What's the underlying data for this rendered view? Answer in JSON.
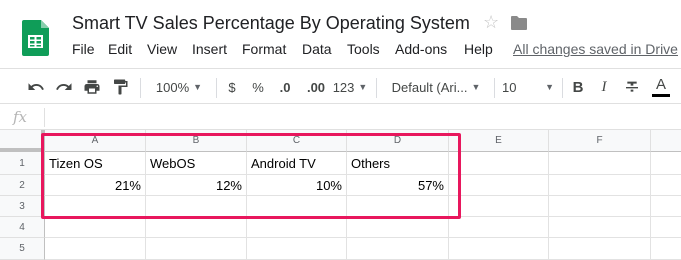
{
  "document": {
    "title": "Smart TV Sales Percentage By Operating System",
    "save_status": "All changes saved in Drive",
    "icons": [
      "sheets-logo",
      "star-icon",
      "folder-icon"
    ]
  },
  "menu": [
    "File",
    "Edit",
    "View",
    "Insert",
    "Format",
    "Data",
    "Tools",
    "Add-ons",
    "Help"
  ],
  "toolbar": {
    "zoom": "100%",
    "currency": "$",
    "percent": "%",
    "decrease_decimal": ".0",
    "increase_decimal": ".00",
    "more_formats": "123",
    "font": "Default (Ari...",
    "font_size": "10",
    "bold": "B",
    "italic": "I",
    "text_color": "A",
    "icons": [
      "undo-icon",
      "redo-icon",
      "print-icon",
      "paint-format-icon",
      "strikethrough-icon"
    ]
  },
  "formula_bar": {
    "label": "fx",
    "value": ""
  },
  "sheet": {
    "columns": [
      "A",
      "B",
      "C",
      "D",
      "E",
      "F"
    ],
    "rows": [
      "1",
      "2",
      "3",
      "4",
      "5"
    ],
    "cells": [
      [
        "Tizen OS",
        "WebOS",
        "Android TV",
        "Others",
        "",
        ""
      ],
      [
        "21%",
        "12%",
        "10%",
        "57%",
        "",
        ""
      ],
      [
        "",
        "",
        "",
        "",
        "",
        ""
      ],
      [
        "",
        "",
        "",
        "",
        "",
        ""
      ],
      [
        "",
        "",
        "",
        "",
        "",
        ""
      ]
    ]
  },
  "colors": {
    "sheets_green": "#0F9D58",
    "highlight_border": "#E8175D",
    "header_background": "#F8F9FA"
  }
}
